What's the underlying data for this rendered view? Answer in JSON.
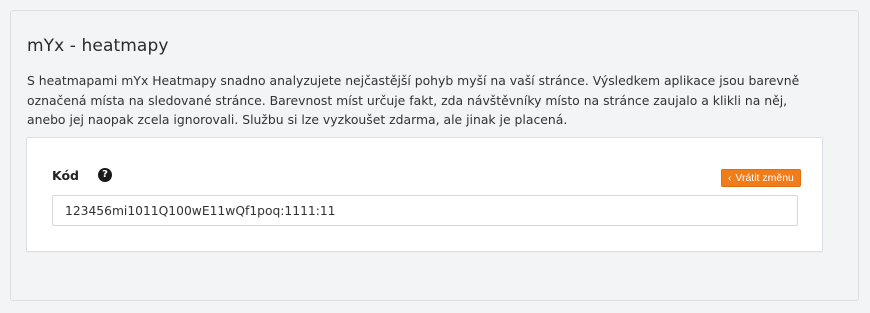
{
  "section": {
    "title": "mYx - heatmapy",
    "description": "S heatmapami mYx Heatmapy snadno analyzujete nejčastější pohyb myší na vaší stránce. Výsledkem aplikace jsou barevně označená místa na sledované stránce. Barevnost míst určuje fakt, zda návštěvníky místo na stránce zaujalo a klikli na něj, anebo jej naopak zcela ignorovali. Službu si lze vyzkoušet zdarma, ale jinak je placená."
  },
  "form": {
    "code_label": "Kód",
    "help_icon": "question-circle-icon",
    "help_glyph": "?",
    "revert_icon": "chevron-left-icon",
    "revert_glyph": "‹",
    "revert_label": "Vrátit změnu",
    "code_value": "123456mi1011Q100wE11wQf1poq:1111:11"
  },
  "colors": {
    "accent": "#f07c1a",
    "background": "#f3f4f6",
    "card": "#ffffff"
  }
}
